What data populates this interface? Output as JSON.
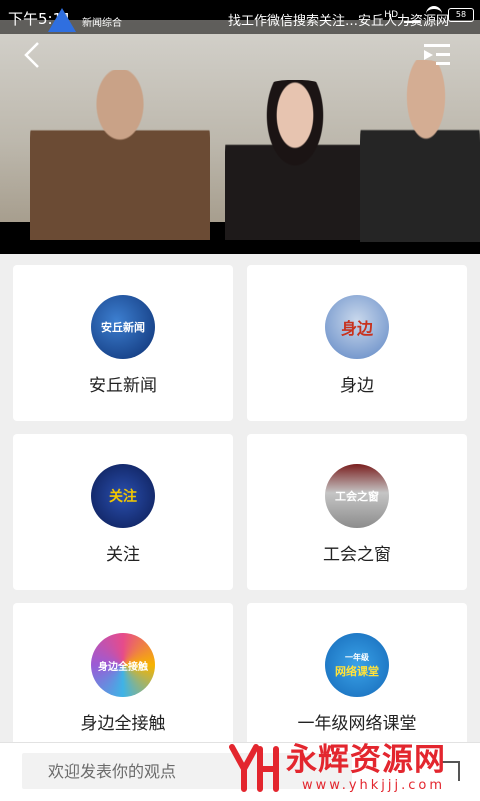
{
  "status": {
    "time": "下午5:11",
    "marquee": "找工作微信搜索关注…安丘人力资源网",
    "battery": "58",
    "network": "HD"
  },
  "player": {
    "channel_logo_text": "新闻综合"
  },
  "programs": [
    {
      "label": "安丘新闻",
      "thumb_text": "安丘新闻",
      "icon": "anqiu-news-logo"
    },
    {
      "label": "身边",
      "thumb_text": "身边",
      "icon": "shenbian-logo"
    },
    {
      "label": "关注",
      "thumb_text": "关注",
      "icon": "guanzhu-logo"
    },
    {
      "label": "工会之窗",
      "thumb_text": "工会之窗",
      "icon": "gonghui-logo"
    },
    {
      "label": "身边全接触",
      "thumb_text": "身边全接触",
      "icon": "shenbian-quanjiechu-logo"
    },
    {
      "label": "一年级网络课堂",
      "thumb_text": "网络课堂",
      "thumb_sub": "一年级",
      "icon": "online-class-logo"
    }
  ],
  "comment": {
    "placeholder": "欢迎发表你的观点"
  },
  "watermark": {
    "title": "永辉资源网",
    "url": "www.yhkjjj.com"
  },
  "colors": {
    "accent": "#e3262e",
    "card_bg": "#ffffff",
    "page_bg": "#efefef"
  }
}
